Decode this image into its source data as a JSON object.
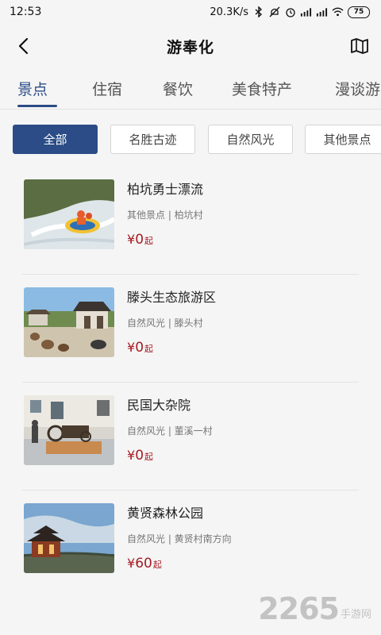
{
  "status": {
    "time": "12:53",
    "network_speed": "20.3K/s",
    "battery": "75",
    "icons": [
      "bluetooth-icon",
      "mute-icon",
      "alarm-icon",
      "hd-signal-icon",
      "signal-icon",
      "wifi-icon",
      "battery-icon"
    ]
  },
  "header": {
    "title": "游奉化",
    "back_icon": "chevron-left-icon",
    "map_icon": "map-icon"
  },
  "tabs": [
    {
      "label": "景点",
      "active": true
    },
    {
      "label": "住宿",
      "active": false
    },
    {
      "label": "餐饮",
      "active": false
    },
    {
      "label": "美食特产",
      "active": false
    },
    {
      "label": "漫谈游",
      "active": false
    }
  ],
  "filters": [
    {
      "label": "全部",
      "active": true
    },
    {
      "label": "名胜古迹",
      "active": false
    },
    {
      "label": "自然风光",
      "active": false
    },
    {
      "label": "其他景点",
      "active": false
    }
  ],
  "items": [
    {
      "title": "柏坑勇士漂流",
      "category": "其他景点",
      "location": "柏坑村",
      "meta": "其他景点 | 柏坑村",
      "yen": "¥",
      "price": "0",
      "suffix": "起",
      "image": "rafting-photo"
    },
    {
      "title": "滕头生态旅游区",
      "category": "自然风光",
      "location": "滕头村",
      "meta": "自然风光 | 滕头村",
      "yen": "¥",
      "price": "0",
      "suffix": "起",
      "image": "pavilion-photo"
    },
    {
      "title": "民国大杂院",
      "category": "自然风光",
      "location": "董溪一村",
      "meta": "自然风光 | 董溪一村",
      "yen": "¥",
      "price": "0",
      "suffix": "起",
      "image": "courtyard-exhibit-photo"
    },
    {
      "title": "黄贤森林公园",
      "category": "自然风光",
      "location": "黄贤村南方向",
      "meta": "自然风光 | 黄贤村南方向",
      "yen": "¥",
      "price": "60",
      "suffix": "起",
      "image": "tower-landscape-photo"
    }
  ],
  "watermark": {
    "number": "2265",
    "text": "手游网"
  },
  "colors": {
    "accent": "#2b4c86",
    "price": "#a51c24",
    "background": "#f5f5f5"
  }
}
